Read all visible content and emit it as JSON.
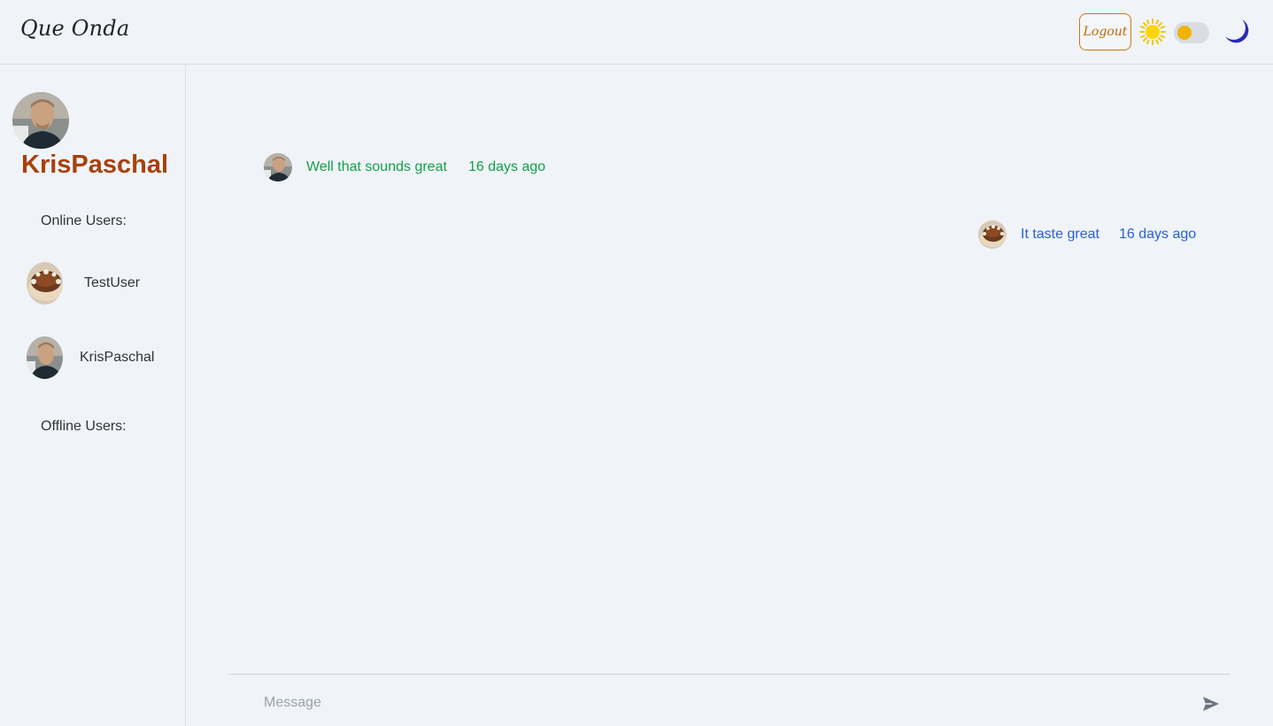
{
  "header": {
    "brand": "Que Onda",
    "logout_label": "Logout",
    "theme_toggle": {
      "mode": "light"
    }
  },
  "sidebar": {
    "current_user": {
      "name": "KrisPaschal"
    },
    "online_label": "Online Users:",
    "online_users": [
      {
        "name": "TestUser",
        "avatar": "cake"
      },
      {
        "name": "KrisPaschal",
        "avatar": "man"
      }
    ],
    "offline_label": "Offline Users:"
  },
  "messages": [
    {
      "text": "Well that sounds great",
      "time": "16 days ago",
      "side": "left",
      "avatar": "man"
    },
    {
      "text": "It taste great",
      "time": "16 days ago",
      "side": "right",
      "avatar": "cake"
    }
  ],
  "composer": {
    "placeholder": "Message"
  },
  "colors": {
    "background": "#f0f4f8",
    "accent_orange": "#a8410c",
    "message_green": "#13a049",
    "message_blue": "#2860d8",
    "logout_border": "#c8781a"
  }
}
